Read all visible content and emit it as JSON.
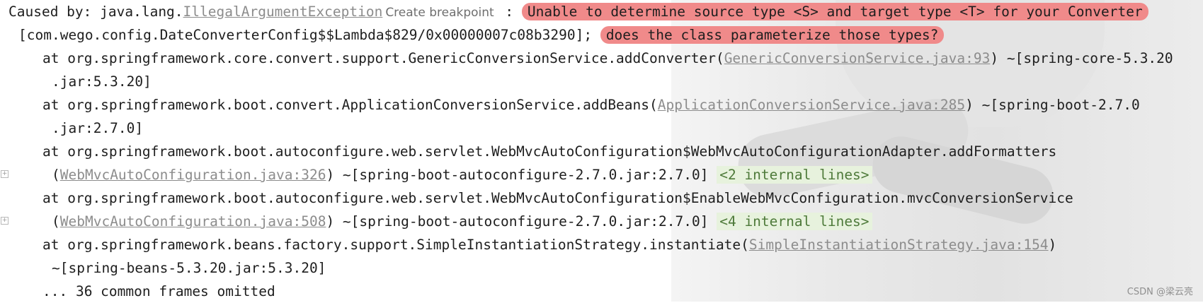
{
  "tooltip": "Create breakpoint",
  "log": {
    "caused_by_prefix": "Caused by: java.lang.",
    "exception_link": "IllegalArgumentException",
    "colon": " : ",
    "error_message_1": "Unable to determine source type <S> and target type <T> for your Converter",
    "lambda_text": "[com.wego.config.DateConverterConfig$$Lambda$829/0x00000007c08b3290]; ",
    "error_message_2": "does the class parameterize those types?",
    "frames": [
      {
        "prefix": "at org.springframework.core.convert.support.GenericConversionService.addConverter(",
        "link": "GenericConversionService.java:93",
        "suffix": ") ~[spring-core-5.3.20",
        "continuation": ".jar:5.3.20]"
      },
      {
        "prefix": "at org.springframework.boot.convert.ApplicationConversionService.addBeans(",
        "link": "ApplicationConversionService.java:285",
        "suffix": ") ~[spring-boot-2.7.0",
        "continuation": ".jar:2.7.0]"
      },
      {
        "prefix": "at org.springframework.boot.autoconfigure.web.servlet.WebMvcAutoConfiguration$WebMvcAutoConfigurationAdapter.addFormatters",
        "cont_prefix": "(",
        "link": "WebMvcAutoConfiguration.java:326",
        "cont_suffix": ") ~[spring-boot-autoconfigure-2.7.0.jar:2.7.0] ",
        "internal": "<2 internal lines>"
      },
      {
        "prefix": "at org.springframework.boot.autoconfigure.web.servlet.WebMvcAutoConfiguration$EnableWebMvcConfiguration.mvcConversionService",
        "cont_prefix": "(",
        "link": "WebMvcAutoConfiguration.java:508",
        "cont_suffix": ") ~[spring-boot-autoconfigure-2.7.0.jar:2.7.0] ",
        "internal": "<4 internal lines>"
      },
      {
        "prefix": "at org.springframework.beans.factory.support.SimpleInstantiationStrategy.instantiate(",
        "link": "SimpleInstantiationStrategy.java:154",
        "suffix": ")",
        "continuation": "~[spring-beans-5.3.20.jar:5.3.20]"
      }
    ],
    "omitted": "... 36 common frames omitted"
  },
  "fold_icon": "plus-square-icon",
  "watermark": "CSDN @梁云亮"
}
